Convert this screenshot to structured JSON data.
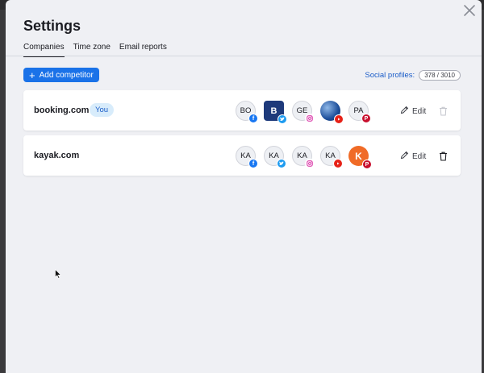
{
  "window": {
    "title": "Settings"
  },
  "tabs": [
    {
      "label": "Companies",
      "active": true
    },
    {
      "label": "Time zone",
      "active": false
    },
    {
      "label": "Email reports",
      "active": false
    }
  ],
  "toolbar": {
    "add_label": "Add competitor",
    "add_icon": "plus-icon",
    "social_label": "Social profiles:",
    "social_count": "378 / 3010"
  },
  "companies": [
    {
      "name": "booking.com",
      "badge": "You",
      "profiles": [
        {
          "text": "BO",
          "network": "facebook",
          "style": "initials"
        },
        {
          "text": "B",
          "network": "twitter",
          "style": "booking-logo"
        },
        {
          "text": "GE",
          "network": "instagram",
          "style": "initials"
        },
        {
          "text": "",
          "network": "youtube",
          "style": "globe"
        },
        {
          "text": "PA",
          "network": "pinterest",
          "style": "initials"
        }
      ],
      "edit_label": "Edit",
      "delete_enabled": false
    },
    {
      "name": "kayak.com",
      "badge": "",
      "profiles": [
        {
          "text": "KA",
          "network": "facebook",
          "style": "initials"
        },
        {
          "text": "KA",
          "network": "twitter",
          "style": "initials"
        },
        {
          "text": "KA",
          "network": "instagram",
          "style": "initials"
        },
        {
          "text": "KA",
          "network": "youtube",
          "style": "initials"
        },
        {
          "text": "K",
          "network": "pinterest",
          "style": "kayak-logo"
        }
      ],
      "edit_label": "Edit",
      "delete_enabled": true
    }
  ],
  "colors": {
    "accent": "#1a72e8",
    "you_badge_bg": "#d8ecfb",
    "modal_bg": "#eff0f4"
  }
}
